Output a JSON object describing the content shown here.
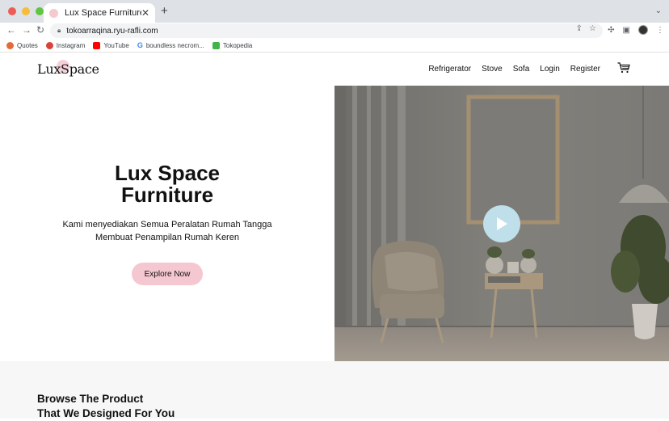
{
  "browser": {
    "tab_title": "Lux Space Furniture",
    "url": "tokoarraqina.ryu-rafli.com",
    "bookmarks": [
      {
        "label": "Quotes"
      },
      {
        "label": "Instagram"
      },
      {
        "label": "YouTube"
      },
      {
        "label": "boundless necrom..."
      },
      {
        "label": "Tokopedia"
      }
    ]
  },
  "site": {
    "logo": "LuxSpace",
    "nav": [
      "Refrigerator",
      "Stove",
      "Sofa",
      "Login",
      "Register"
    ],
    "hero": {
      "title": "Lux Space\nFurniture",
      "subtitle": "Kami menyediakan Semua Peralatan Rumah Tangga\nMembuat Penampilan Rumah Keren",
      "cta": "Explore Now"
    },
    "browse_title": "Browse The Product\nThat We Designed For You"
  },
  "colors": {
    "accent_pink": "#f5c7d1",
    "play_button": "#bfe0ea"
  },
  "icons": [
    "back-arrow-icon",
    "forward-arrow-icon",
    "reload-icon",
    "lock-icon",
    "share-icon",
    "star-icon",
    "extensions-icon",
    "sidebar-icon",
    "cart-icon",
    "play-icon"
  ]
}
